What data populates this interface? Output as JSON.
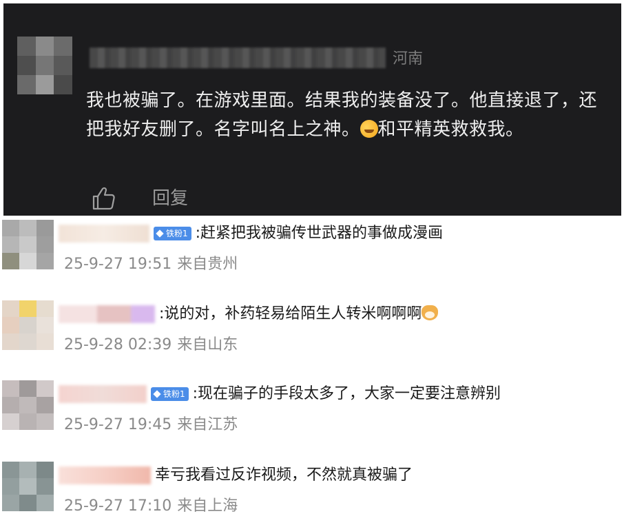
{
  "top_comment": {
    "location": "河南",
    "text_before_emoji": "我也被骗了。在游戏里面。结果我的装备没了。他直接退了，还把我好友删了。名字叫名上之神。",
    "emoji": "crying-laughing-emoji",
    "text_after_emoji": "和平精英救救我。",
    "like_icon": "thumbs-up-icon",
    "reply_label": "回复"
  },
  "comments": [
    {
      "badge": "铁粉1",
      "text": ":赶紧把我被骗传世武器的事做成漫画",
      "time": "25-9-27 19:51",
      "from": "来自贵州"
    },
    {
      "text": ":说的对，补药轻易给陌生人转米啊啊啊",
      "emoji": "dog-face-emoji",
      "time": "25-9-28 02:39",
      "from": "来自山东"
    },
    {
      "badge": "铁粉1",
      "text": ":现在骗子的手段太多了，大家一定要注意辨别",
      "time": "25-9-27 19:45",
      "from": "来自江苏"
    },
    {
      "text": "幸亏我看过反诈视频，不然就真被骗了",
      "time": "25-9-27 17:10",
      "from": "来自上海"
    }
  ],
  "colors": {
    "dark_bg": "#1c1c1e",
    "badge_blue": "#4b8de8",
    "meta_gray": "#8a8a8a"
  }
}
